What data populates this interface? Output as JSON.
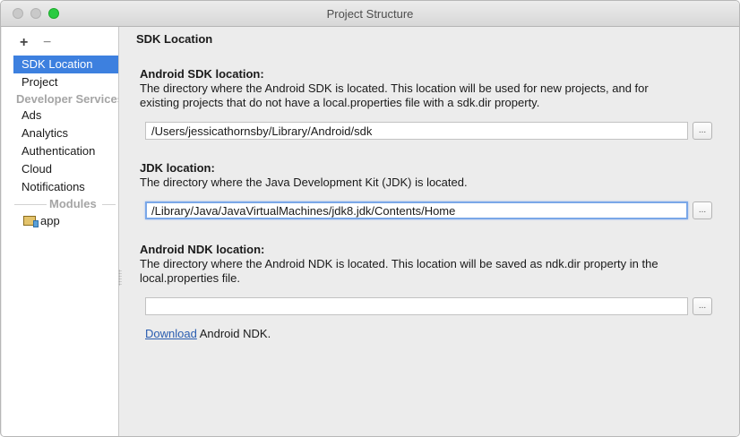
{
  "window": {
    "title": "Project Structure"
  },
  "toolbar": {
    "add": "+",
    "remove": "−"
  },
  "sidebar": {
    "items": [
      {
        "label": "SDK Location"
      },
      {
        "label": "Project"
      }
    ],
    "developer_header": "Developer Services",
    "dev_items": [
      {
        "label": "Ads"
      },
      {
        "label": "Analytics"
      },
      {
        "label": "Authentication"
      },
      {
        "label": "Cloud"
      },
      {
        "label": "Notifications"
      }
    ],
    "modules_header": "Modules",
    "modules": [
      {
        "label": "app"
      }
    ]
  },
  "content": {
    "title": "SDK Location",
    "android_sdk": {
      "label": "Android SDK location:",
      "description_1": "The directory where the Android SDK is located. This location will be used for new projects, and for",
      "description_2": "existing projects that do not have a local.properties file with a sdk.dir property.",
      "value": "/Users/jessicathornsby/Library/Android/sdk",
      "browse": "..."
    },
    "jdk": {
      "label": "JDK location:",
      "description": "The directory where the Java Development Kit (JDK) is located.",
      "value": "/Library/Java/JavaVirtualMachines/jdk8.jdk/Contents/Home",
      "browse": "..."
    },
    "ndk": {
      "label": "Android NDK location:",
      "description_1": "The directory where the Android NDK is located. This location will be saved as ndk.dir property in the",
      "description_2": "local.properties file.",
      "value": "",
      "browse": "...",
      "download_link": "Download",
      "download_suffix": " Android NDK."
    }
  }
}
